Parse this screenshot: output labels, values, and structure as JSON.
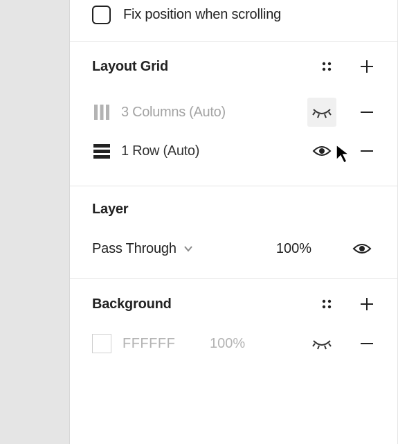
{
  "constraints": {
    "fix_position_label": "Fix position when scrolling"
  },
  "layout_grid": {
    "title": "Layout Grid",
    "items": [
      {
        "label": "3 Columns (Auto)",
        "visible": false,
        "type": "columns"
      },
      {
        "label": "1 Row (Auto)",
        "visible": true,
        "type": "rows"
      }
    ]
  },
  "layer": {
    "title": "Layer",
    "blend_mode": "Pass Through",
    "opacity": "100%"
  },
  "background": {
    "title": "Background",
    "fills": [
      {
        "hex": "FFFFFF",
        "opacity": "100%",
        "visible": false
      }
    ]
  }
}
